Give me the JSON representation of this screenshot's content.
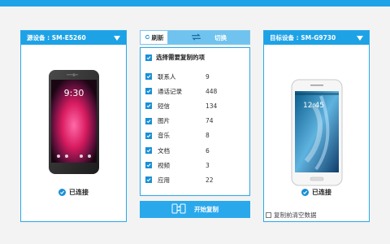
{
  "source_device": {
    "label": "源设备 : SM-E5260",
    "status": "已连接"
  },
  "target_device": {
    "label": "目标设备 : SM-G9730",
    "status": "已连接",
    "clear_label": "复制前清空数据"
  },
  "toolbar": {
    "refresh": "刷新",
    "switch": "切换"
  },
  "content_list": {
    "select_all": "选择需要复制的项",
    "items": [
      {
        "name": "联系人",
        "count": "9"
      },
      {
        "name": "通话记录",
        "count": "448"
      },
      {
        "name": "短信",
        "count": "134"
      },
      {
        "name": "图片",
        "count": "74"
      },
      {
        "name": "音乐",
        "count": "8"
      },
      {
        "name": "文档",
        "count": "6"
      },
      {
        "name": "视频",
        "count": "3"
      },
      {
        "name": "应用",
        "count": "22"
      }
    ]
  },
  "actions": {
    "start_copy": "开始复制"
  },
  "phone_right": {
    "time": "12:45"
  },
  "colors": {
    "accent": "#1ea2e6",
    "check": "#1b8fd6"
  }
}
